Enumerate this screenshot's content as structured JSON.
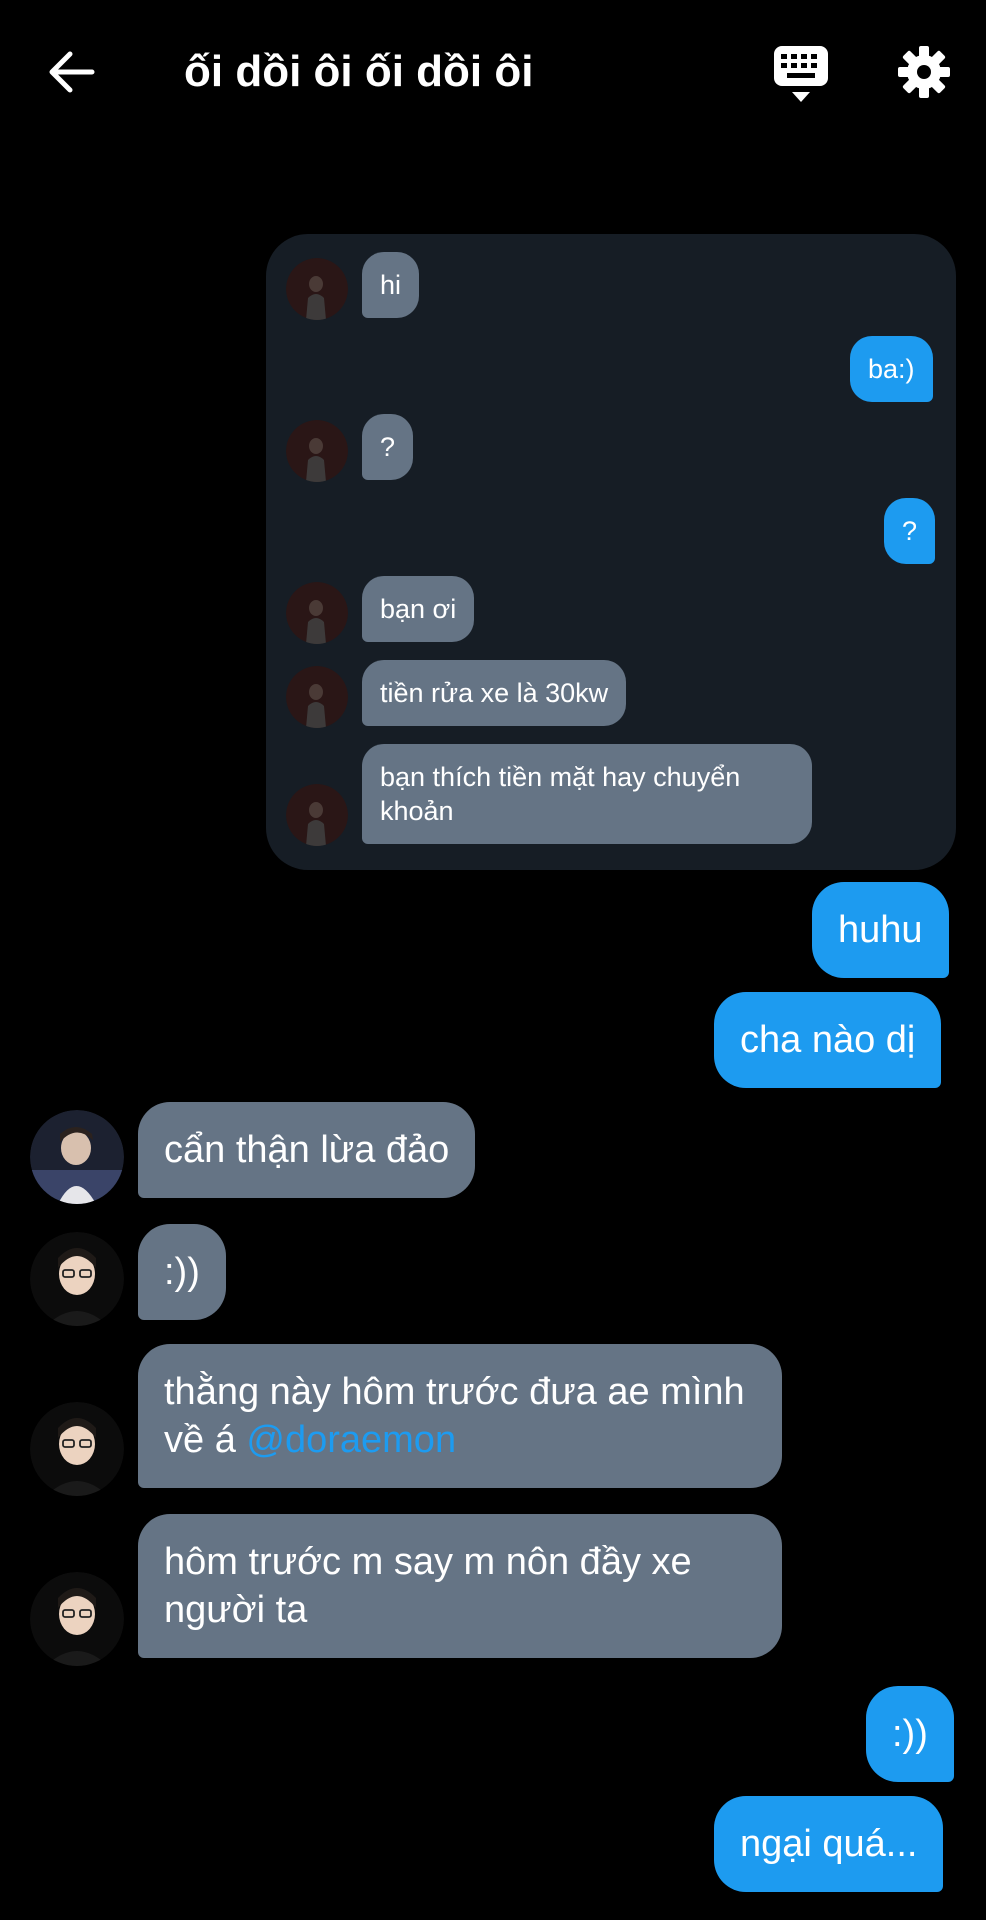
{
  "header": {
    "title": "ối dồi ôi ối dồi ôi",
    "icons": [
      "back-arrow-icon",
      "keyboard-icon",
      "gear-icon"
    ]
  },
  "quoted": {
    "messages": [
      {
        "side": "in",
        "text": "hi"
      },
      {
        "side": "out",
        "text": "ba:)"
      },
      {
        "side": "in",
        "text": "?"
      },
      {
        "side": "out",
        "text": "?"
      },
      {
        "side": "in",
        "text": "bạn ơi"
      },
      {
        "side": "in",
        "text": "tiền rửa xe là 30kw"
      },
      {
        "side": "in",
        "text": "bạn thích tiền mặt hay chuyển khoản"
      }
    ]
  },
  "chat": {
    "m1": "huhu",
    "m2": "cha nào dị",
    "m3": "cẩn thận lừa đảo",
    "m4": ":))",
    "m5_text": "thằng này hôm trước đưa ae mình về á ",
    "m5_mention": "@doraemon",
    "m6": "hôm trước m say m nôn đầy xe người ta",
    "m7": ":))",
    "m8": "ngại quá..."
  },
  "colors": {
    "background": "#000000",
    "incoming_bubble": "#657485",
    "outgoing_bubble": "#1d9bf0",
    "quote_panel": "#161d25",
    "mention": "#1d9bf0"
  }
}
